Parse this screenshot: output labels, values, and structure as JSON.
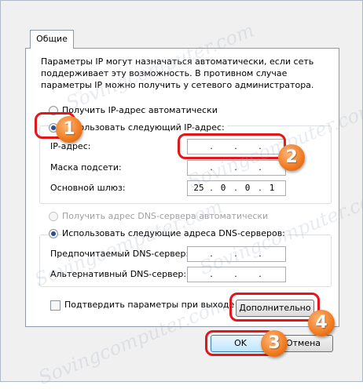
{
  "tab": {
    "label": "Общие"
  },
  "description": "Параметры IP могут назначаться автоматически, если сеть поддерживает эту возможность. В противном случае параметры IP можно получить у сетевого администратора.",
  "ip_mode": {
    "auto_label": "Получить IP-адрес автоматически",
    "manual_label": "Использовать следующий IP-адрес:",
    "selected": "manual"
  },
  "ip_fields": {
    "ip_label": "IP-адрес:",
    "mask_label": "Маска подсети:",
    "gateway_label": "Основной шлюз:",
    "ip_value": [
      "",
      "",
      "",
      ""
    ],
    "mask_value": [
      "",
      "",
      "",
      ""
    ],
    "gateway_value": [
      "25",
      "0",
      "0",
      "1"
    ]
  },
  "dns_mode": {
    "auto_label": "Получить адрес DNS-сервера автоматически",
    "manual_label": "Использовать следующие адреса DNS-серверов:",
    "selected": "manual"
  },
  "dns_fields": {
    "preferred_label": "Предпочитаемый DNS-сервер:",
    "alternate_label": "Альтернативный DNS-сервер:",
    "preferred_value": [
      "",
      "",
      "",
      ""
    ],
    "alternate_value": [
      "",
      "",
      "",
      ""
    ]
  },
  "validate": {
    "label": "Подтвердить параметры при выходе",
    "checked": false
  },
  "buttons": {
    "advanced": "Дополнительно",
    "ok": "OK",
    "cancel": "Отмена"
  },
  "annotations": {
    "badge1": "1",
    "badge2": "2",
    "badge3": "3",
    "badge4": "4",
    "color": "#e3161b"
  },
  "watermark": "Sovingcomputer.com"
}
